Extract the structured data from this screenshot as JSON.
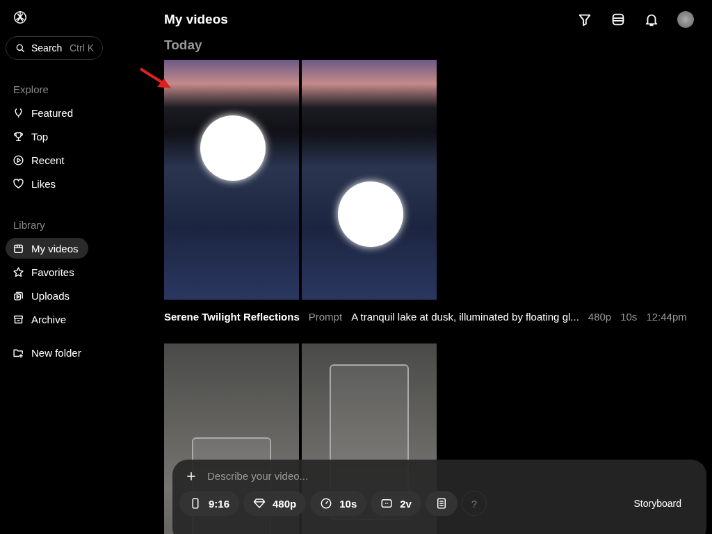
{
  "sidebar": {
    "search": {
      "label": "Search",
      "shortcut": "Ctrl K"
    },
    "sections": [
      {
        "title": "Explore",
        "items": [
          {
            "label": "Featured",
            "selected": false
          },
          {
            "label": "Top",
            "selected": false
          },
          {
            "label": "Recent",
            "selected": false
          },
          {
            "label": "Likes",
            "selected": false
          }
        ]
      },
      {
        "title": "Library",
        "items": [
          {
            "label": "My videos",
            "selected": true
          },
          {
            "label": "Favorites",
            "selected": false
          },
          {
            "label": "Uploads",
            "selected": false
          },
          {
            "label": "Archive",
            "selected": false
          }
        ]
      }
    ],
    "new_folder": "New folder"
  },
  "header": {
    "title": "My videos"
  },
  "day_heading": "Today",
  "groups": [
    {
      "title": "Serene Twilight Reflections",
      "prompt_label": "Prompt",
      "prompt": "A tranquil lake at dusk, illuminated by floating gl...",
      "resolution": "480p",
      "duration": "10s",
      "time": "12:44pm"
    }
  ],
  "composer": {
    "placeholder": "Describe your video...",
    "options": [
      "9:16",
      "480p",
      "10s",
      "2v"
    ],
    "help": "?",
    "storyboard": "Storyboard"
  }
}
